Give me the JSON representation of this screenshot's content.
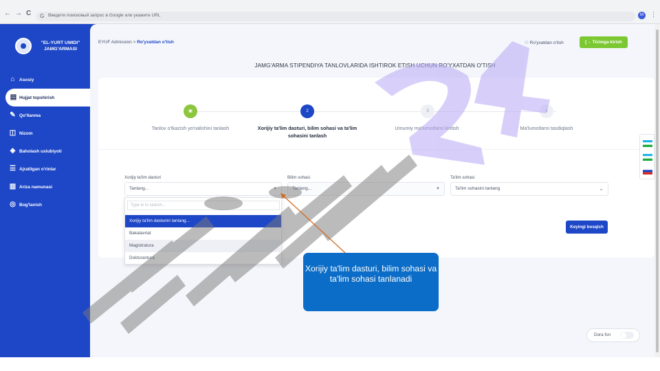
{
  "browser": {
    "url_placeholder": "Введите поисковый запрос в Google или укажите URL",
    "back": "←",
    "forward": "→",
    "reload": "C",
    "google": "G",
    "profile": "M",
    "menu": "⋮"
  },
  "brand": {
    "name": "\"EL-YURT UMIDI\" JAMG'ARMASI"
  },
  "sidebar": {
    "items": [
      {
        "label": "Asosiy",
        "icon": "home-icon"
      },
      {
        "label": "Hujjat topshirish",
        "icon": "document-icon",
        "active": true
      },
      {
        "label": "Qo'llanma",
        "icon": "edit-icon"
      },
      {
        "label": "Nizom",
        "icon": "book-icon"
      },
      {
        "label": "Baholash uslubiyoti",
        "icon": "layers-icon"
      },
      {
        "label": "Ajratilgan o'rinlar",
        "icon": "list-icon"
      },
      {
        "label": "Ariza namunasi",
        "icon": "file-icon"
      },
      {
        "label": "Bog'lanish",
        "icon": "location-icon"
      }
    ]
  },
  "header": {
    "crumb_root": "EYUF Admission",
    "crumb_sep": ">",
    "crumb_current": "Ro'yxatdan o'tish",
    "register_link": "Ro'yxatdan o'tish",
    "login_button": "Tizimga kirish",
    "title": "JAMG'ARMA STIPENDIYA TANLOVLARIDA ISHTIROK ETISH UCHUN RO'YXATDAN O'TISH"
  },
  "steps": [
    {
      "num": "",
      "label": "Tanlov o'tkazish yo'nalishini tanlash",
      "state": "done"
    },
    {
      "num": "2",
      "label": "Xorijiy ta'lim dasturi, bilim sohasi va ta'lim sohasini tanlash",
      "state": "current"
    },
    {
      "num": "3",
      "label": "Umumiy ma'lumotlarni kiritish",
      "state": "pending"
    },
    {
      "num": "4",
      "label": "Ma'lumotlarni tasdiqlash",
      "state": "pending"
    }
  ],
  "form": {
    "program_label": "Xorijiy ta'lim dasturi",
    "program_value": "Tanlang...",
    "field_label": "Bilim sohasi",
    "field_value": "Tanlang...",
    "area_label": "Ta'lim sohasi",
    "area_value": "Ta'lim sohasini tanlang",
    "next_button": "Keyingi bosqich"
  },
  "dropdown": {
    "search_placeholder": "Type in to search...",
    "options": [
      {
        "label": "Xorijiy ta'lim dasturini tanlang...",
        "state": "selected"
      },
      {
        "label": "Bakalavriat",
        "state": ""
      },
      {
        "label": "Magistratura",
        "state": "hover"
      },
      {
        "label": "Doktorantura",
        "state": ""
      }
    ]
  },
  "theme_toggle": {
    "label": "Dora fon",
    "on": false
  },
  "languages": [
    "uz-latin",
    "uz-cyrillic",
    "ru"
  ],
  "callout": {
    "text": "Xorijiy ta'lim dasturi, bilim sohasi va ta'lim sohasi tanlanadi"
  },
  "watermark": {
    "text": "Hujjat 24"
  },
  "colors": {
    "primary": "#1e47c7",
    "success": "#7cc832",
    "callout": "#0b6dc7"
  }
}
